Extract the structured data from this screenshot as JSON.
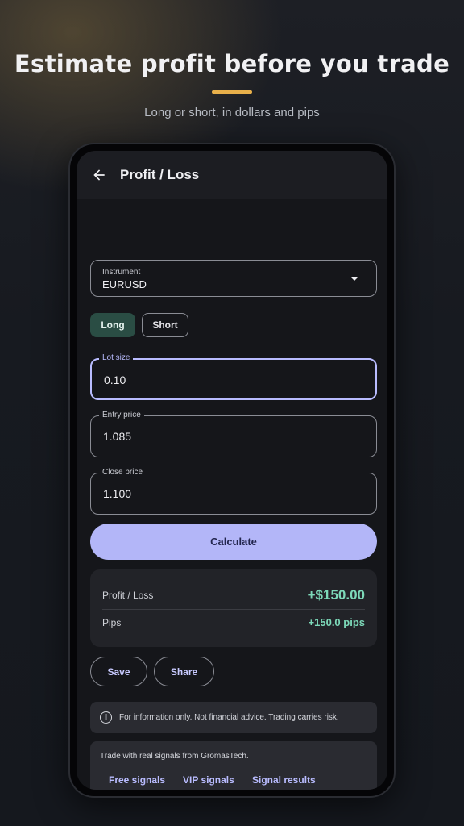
{
  "promo_header": {
    "headline": "Estimate profit before you trade",
    "subheadline": "Long or short, in dollars and pips",
    "accent_color": "#e8b04a"
  },
  "app_bar": {
    "title": "Profit / Loss",
    "back_icon": "arrow-left-icon"
  },
  "form": {
    "instrument": {
      "label": "Instrument",
      "value": "EURUSD",
      "icon": "dropdown-caret-icon"
    },
    "direction": {
      "options": [
        "Long",
        "Short"
      ],
      "selected": "Long"
    },
    "lot_size": {
      "label": "Lot size",
      "value": "0.10"
    },
    "entry_price": {
      "label": "Entry price",
      "value": "1.085"
    },
    "close_price": {
      "label": "Close price",
      "value": "1.100"
    },
    "calculate_label": "Calculate"
  },
  "result": {
    "profit_loss_label": "Profit / Loss",
    "profit_loss_value": "+$150.00",
    "pips_label": "Pips",
    "pips_value": "+150.0 pips",
    "positive_color": "#7dd9b9"
  },
  "actions": {
    "save_label": "Save",
    "share_label": "Share"
  },
  "disclaimer": {
    "icon": "info-icon",
    "text": "For information only. Not financial advice. Trading carries risk."
  },
  "promo": {
    "text": "Trade with real signals from GromasTech.",
    "links": [
      "Free signals",
      "VIP signals",
      "Signal results"
    ]
  },
  "colors": {
    "accent_primary": "#b3b6f8",
    "long_toggle": "#2a4d44",
    "background": "#15161a"
  }
}
